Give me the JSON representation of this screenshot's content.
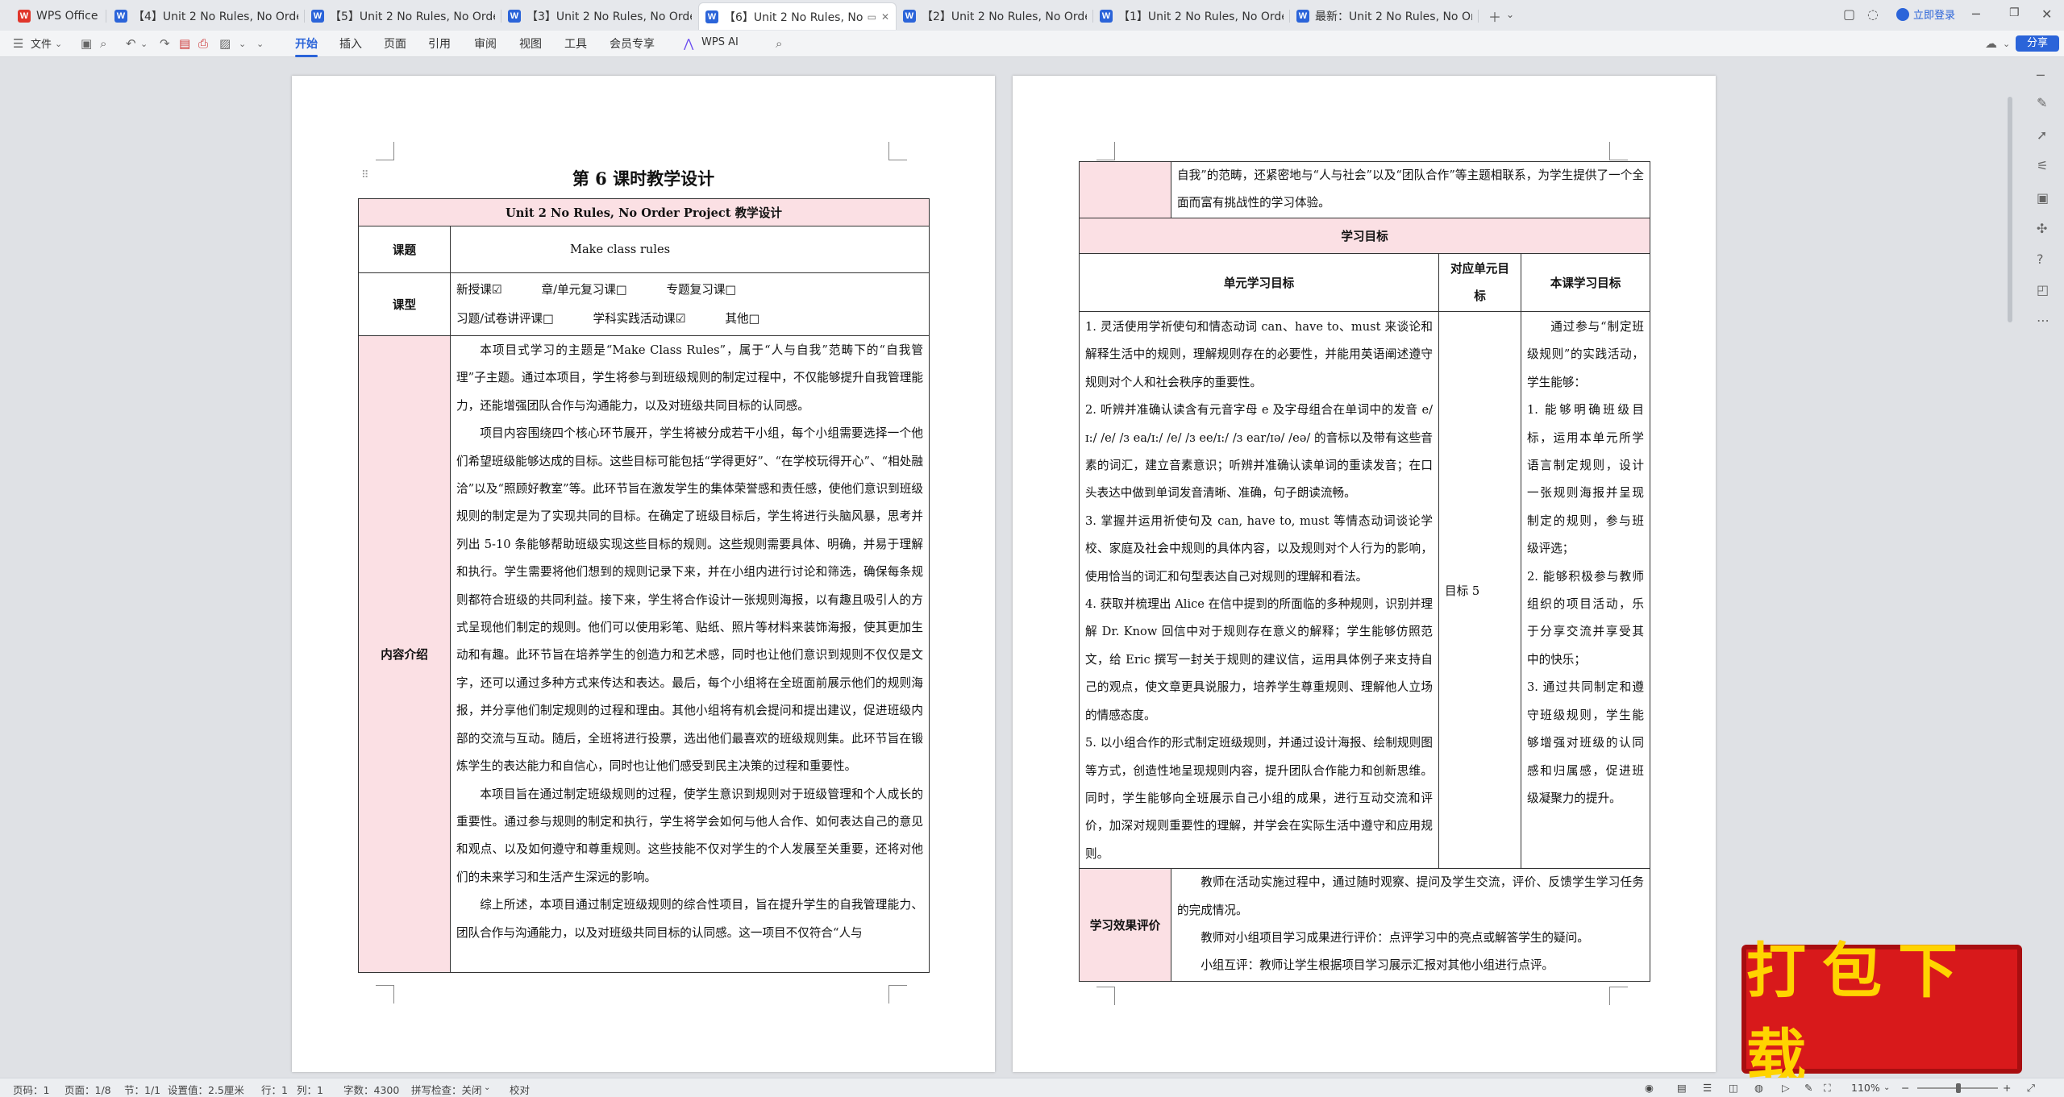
{
  "app": {
    "home_tab": "WPS Office",
    "tabs": [
      {
        "label": "【4】Unit 2 No Rules, No Order新"
      },
      {
        "label": "【5】Unit 2 No Rules, No Order新"
      },
      {
        "label": "【3】Unit 2 No Rules, No Order新"
      },
      {
        "label": "【6】Unit 2 No Rules, No O"
      },
      {
        "label": "【2】Unit 2 No Rules, No Order新"
      },
      {
        "label": "【1】Unit 2 No Rules, No Order新"
      },
      {
        "label": "最新：Unit 2 No Rules, No Order"
      }
    ],
    "login_label": "立即登录"
  },
  "ribbon": {
    "file_menu": "文件",
    "tabs": [
      "开始",
      "插入",
      "页面",
      "引用",
      "审阅",
      "视图",
      "工具",
      "会员专享"
    ],
    "active_tab": "开始",
    "ai_label": "WPS AI",
    "share_label": "分享"
  },
  "page1": {
    "title": "第 6 课时教学设计",
    "header": "Unit 2 No Rules, No Order    Project 教学设计",
    "topic_label": "课题",
    "topic_value": "Make class rules",
    "type_label": "课型",
    "type_options_row1": [
      "新授课☑",
      "章/单元复习课□",
      "专题复习课□"
    ],
    "type_options_row2": [
      "习题/试卷讲评课□",
      "学科实践活动课☑",
      "其他□"
    ],
    "content_label": "内容介绍",
    "paragraphs": [
      "本项目式学习的主题是“Make Class Rules”，属于“人与自我”范畴下的“自我管理”子主题。通过本项目，学生将参与到班级规则的制定过程中，不仅能够提升自我管理能力，还能增强团队合作与沟通能力，以及对班级共同目标的认同感。",
      "项目内容围绕四个核心环节展开，学生将被分成若干小组，每个小组需要选择一个他们希望班级能够达成的目标。这些目标可能包括“学得更好”、“在学校玩得开心”、“相处融洽”以及“照顾好教室”等。此环节旨在激发学生的集体荣誉感和责任感，使他们意识到班级规则的制定是为了实现共同的目标。在确定了班级目标后，学生将进行头脑风暴，思考并列出 5-10 条能够帮助班级实现这些目标的规则。这些规则需要具体、明确，并易于理解和执行。学生需要将他们想到的规则记录下来，并在小组内进行讨论和筛选，确保每条规则都符合班级的共同利益。接下来，学生将合作设计一张规则海报，以有趣且吸引人的方式呈现他们制定的规则。他们可以使用彩笔、贴纸、照片等材料来装饰海报，使其更加生动和有趣。此环节旨在培养学生的创造力和艺术感，同时也让他们意识到规则不仅仅是文字，还可以通过多种方式来传达和表达。最后，每个小组将在全班面前展示他们的规则海报，并分享他们制定规则的过程和理由。其他小组将有机会提问和提出建议，促进班级内部的交流与互动。随后，全班将进行投票，选出他们最喜欢的班级规则集。此环节旨在锻炼学生的表达能力和自信心，同时也让他们感受到民主决策的过程和重要性。",
      "本项目旨在通过制定班级规则的过程，使学生意识到规则对于班级管理和个人成长的重要性。通过参与规则的制定和执行，学生将学会如何与他人合作、如何表达自己的意见和观点、以及如何遵守和尊重规则。这些技能不仅对学生的个人发展至关重要，还将对他们的未来学习和生活产生深远的影响。",
      "综上所述，本项目通过制定班级规则的综合性项目，旨在提升学生的自我管理能力、团队合作与沟通能力，以及对班级共同目标的认同感。这一项目不仅符合“人与"
    ]
  },
  "page2": {
    "continued_text": "自我”的范畴，还紧密地与“人与社会”以及“团队合作”等主题相联系，为学生提供了一个全面而富有挑战性的学习体验。",
    "goals_header": "学习目标",
    "col_unit_goals": "单元学习目标",
    "col_matching": "对应单元目标",
    "col_lesson_goals": "本课学习目标",
    "unit_goals": [
      "1. 灵活使用学祈使句和情态动词 can、have to、must 来谈论和解释生活中的规则，理解规则存在的必要性，并能用英语阐述遵守规则对个人和社会秩序的重要性。",
      "2. 听辨并准确认读含有元音字母 e 及字母组合在单词中的发音 e/ɪ:/ /e/ /ɜ  ea/ɪ:/ /e/ /ɜ  ee/ɪ:/ /ɜ  ear/ɪə/ /eə/ 的音标以及带有这些音素的词汇，建立音素意识；听辨并准确认读单词的重读发音；在口头表达中做到单词发音清晰、准确，句子朗读流畅。",
      "3. 掌握并运用祈使句及 can, have to, must 等情态动词谈论学校、家庭及社会中规则的具体内容，以及规则对个人行为的影响，使用恰当的词汇和句型表达自己对规则的理解和看法。",
      "4. 获取并梳理出 Alice 在信中提到的所面临的多种规则，识别并理解 Dr. Know 回信中对于规则存在意义的解释；学生能够仿照范文，给 Eric 撰写一封关于规则的建议信，运用具体例子来支持自己的观点，使文章更具说服力，培养学生尊重规则、理解他人立场的情感态度。",
      "5. 以小组合作的形式制定班级规则，并通过设计海报、绘制规则图等方式，创造性地呈现规则内容，提升团队合作能力和创新思维。同时，学生能够向全班展示自己小组的成果，进行互动交流和评价，加深对规则重要性的理解，并学会在实际生活中遵守和应用规则。"
    ],
    "matching_goal": "目标 5",
    "lesson_goals_intro": "通过参与“制定班级规则”的实践活动，学生能够：",
    "lesson_goals": [
      "1. 能够明确班级目标，运用本单元所学语言制定规则，设计一张规则海报并呈现制定的规则，参与班级评选；",
      "2. 能够积极参与教师组织的项目活动，乐于分享交流并享受其中的快乐；",
      "3. 通过共同制定和遵守班级规则，学生能够增强对班级的认同感和归属感，促进班级凝聚力的提升。"
    ],
    "eval_label": "学习效果评价",
    "eval_paragraphs": [
      "教师在活动实施过程中，通过随时观察、提问及学生交流，评价、反馈学生学习任务的完成情况。",
      "教师对小组项目学习成果进行评价：点评学习中的亮点或解答学生的疑问。",
      "小组互评：教师让学生根据项目学习展示汇报对其他小组进行点评。"
    ]
  },
  "status": {
    "page_num": "页码：1",
    "pages": "页面：1/8",
    "section": "节：1/1",
    "setting": "设置值：2.5厘米",
    "row": "行：1",
    "col": "列：1",
    "words": "字数：4300",
    "spell": "拼写检查：关闭",
    "proof": "校对",
    "zoom": "110%"
  },
  "download_badge": "打包下载"
}
